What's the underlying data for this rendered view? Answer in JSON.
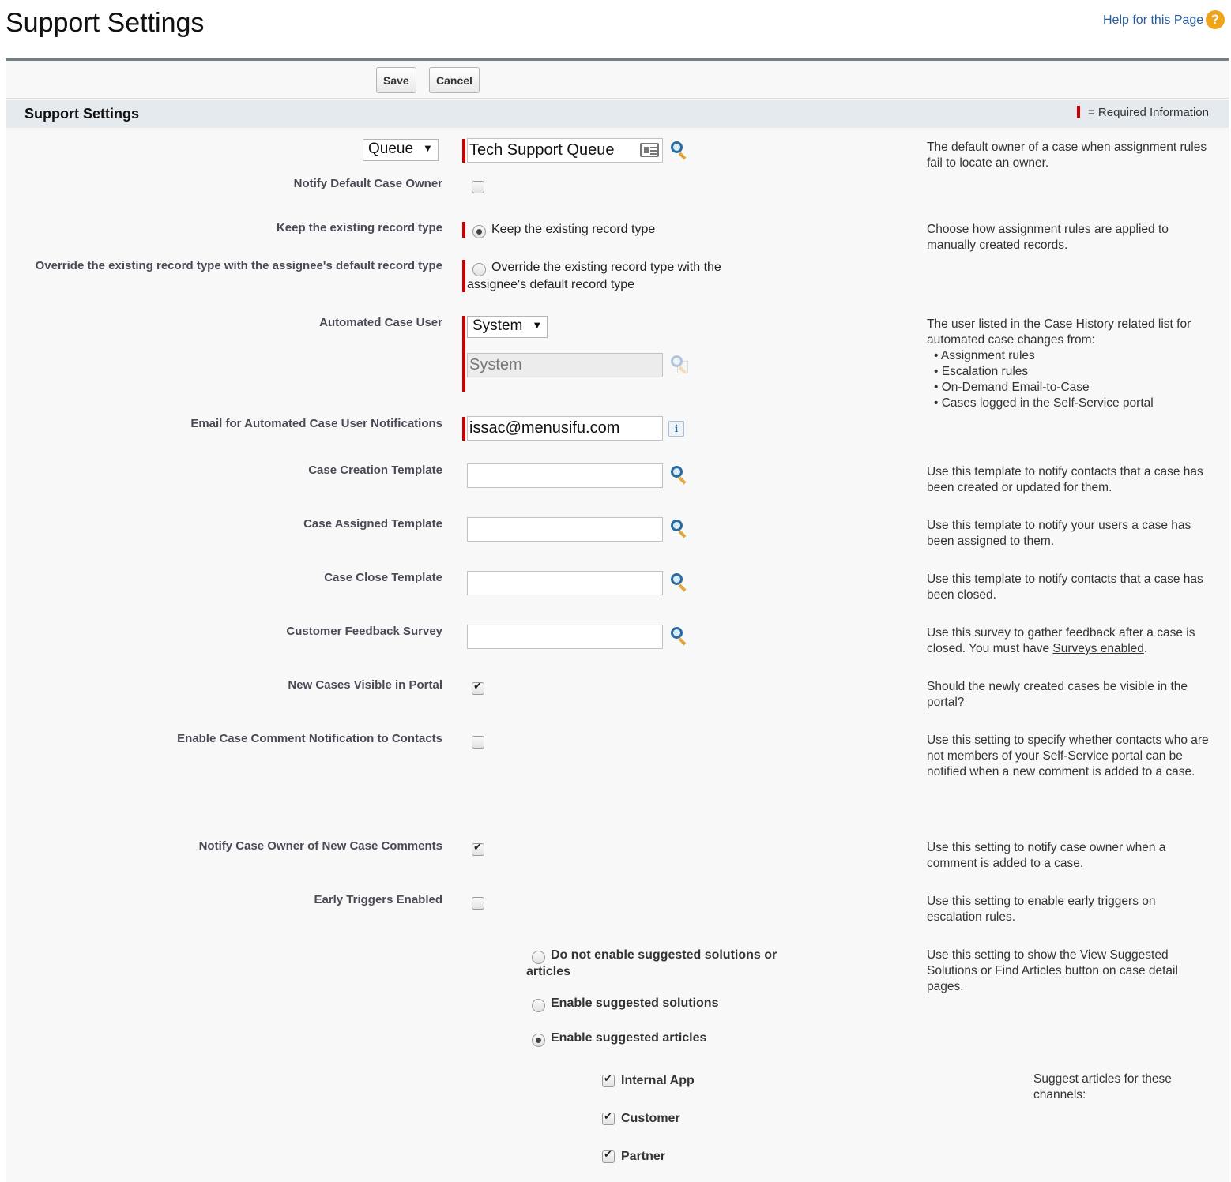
{
  "header": {
    "title": "Support Settings",
    "help_link": "Help for this Page",
    "help_icon": "?"
  },
  "toolbar": {
    "save_label": "Save",
    "cancel_label": "Cancel"
  },
  "section": {
    "title": "Support Settings",
    "required_legend": "= Required Information"
  },
  "default_case_owner": {
    "type_select": "Queue",
    "value": "Tech Support Queue",
    "help": "The default owner of a case when assignment rules fail to locate an owner."
  },
  "notify_default_owner": {
    "label": "Notify Default Case Owner",
    "checked": false
  },
  "record_type": {
    "keep_label": "Keep the existing record type",
    "keep_option": "Keep the existing record type",
    "override_label": "Override the existing record type with the assignee's default record type",
    "override_option": "Override the existing record type with the assignee's default record type",
    "selected": "keep",
    "help": "Choose how assignment rules are applied to manually created records."
  },
  "automated_case_user": {
    "label": "Automated Case User",
    "select": "System",
    "value": "System",
    "help_intro": "The user listed in the Case History related list for automated case changes from:",
    "help_items": [
      "Assignment rules",
      "Escalation rules",
      "On-Demand Email-to-Case",
      "Cases logged in the Self-Service portal"
    ]
  },
  "automated_email": {
    "label": "Email for Automated Case User Notifications",
    "value": "issac@menusifu.com",
    "info_icon": "i"
  },
  "case_creation_template": {
    "label": "Case Creation Template",
    "value": "",
    "help": "Use this template to notify contacts that a case has been created or updated for them."
  },
  "case_assigned_template": {
    "label": "Case Assigned Template",
    "value": "",
    "help": "Use this template to notify your users a case has been assigned to them."
  },
  "case_close_template": {
    "label": "Case Close Template",
    "value": "",
    "help": "Use this template to notify contacts that a case has been closed."
  },
  "customer_feedback_survey": {
    "label": "Customer Feedback Survey",
    "value": "",
    "help_prefix": "Use this survey to gather feedback after a case is closed. You must have ",
    "help_link": "Surveys enabled",
    "help_suffix": "."
  },
  "new_cases_visible": {
    "label": "New Cases Visible in Portal",
    "checked": true,
    "help": "Should the newly created cases be visible in the portal?"
  },
  "comment_notification": {
    "label": "Enable Case Comment Notification to Contacts",
    "checked": false,
    "help": "Use this setting to specify whether contacts who are not members of your Self-Service portal can be notified when a new comment is added to a case."
  },
  "notify_owner_comments": {
    "label": "Notify Case Owner of New Case Comments",
    "checked": true,
    "help": "Use this setting to notify case owner when a comment is added to a case."
  },
  "early_triggers": {
    "label": "Early Triggers Enabled",
    "checked": false,
    "help": "Use this setting to enable early triggers on escalation rules."
  },
  "suggested": {
    "options": [
      "Do not enable suggested solutions or articles",
      "Enable suggested solutions",
      "Enable suggested articles"
    ],
    "selected": 2,
    "help": "Use this setting to show the View Suggested Solutions or Find Articles button on case detail pages."
  },
  "channels": {
    "help": "Suggest articles for these channels:",
    "items": [
      {
        "label": "Internal App",
        "checked": true
      },
      {
        "label": "Customer",
        "checked": true
      },
      {
        "label": "Partner",
        "checked": true
      }
    ]
  }
}
